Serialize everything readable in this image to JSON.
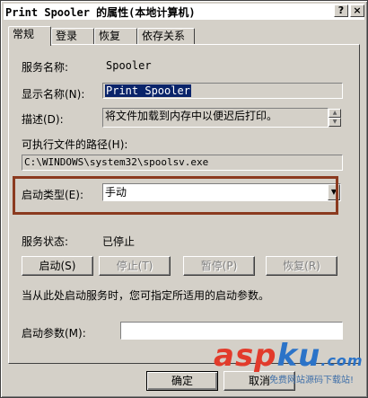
{
  "window": {
    "title": "Print Spooler 的属性(本地计算机)",
    "help_button": "?",
    "close_button": "×"
  },
  "tabs": [
    {
      "label": "常规",
      "active": true
    },
    {
      "label": "登录",
      "active": false
    },
    {
      "label": "恢复",
      "active": false
    },
    {
      "label": "依存关系",
      "active": false
    }
  ],
  "general": {
    "service_name_label": "服务名称:",
    "service_name_value": "Spooler",
    "display_name_label": "显示名称(N):",
    "display_name_value": "Print Spooler",
    "description_label": "描述(D):",
    "description_value": "将文件加载到内存中以便迟后打印。",
    "exe_path_label": "可执行文件的路径(H):",
    "exe_path_value": "C:\\WINDOWS\\system32\\spoolsv.exe",
    "startup_type_label": "启动类型(E):",
    "startup_type_value": "手动",
    "service_status_label": "服务状态:",
    "service_status_value": "已停止",
    "start_button": "启动(S)",
    "stop_button": "停止(T)",
    "pause_button": "暂停(P)",
    "resume_button": "恢复(R)",
    "hint_text": "当从此处启动服务时，您可指定所适用的启动参数。",
    "start_params_label": "启动参数(M):",
    "start_params_value": ""
  },
  "footer": {
    "ok_button": "确定",
    "cancel_button": "取消"
  },
  "watermark": {
    "brand_a": "asp",
    "brand_b": "ku",
    "brand_suffix": ".com",
    "subtitle": "免费网站源码下载站!"
  },
  "colors": {
    "highlight_box": "#8b3a1f",
    "selection": "#0a246a",
    "dialog_face": "#d4d0c8"
  }
}
